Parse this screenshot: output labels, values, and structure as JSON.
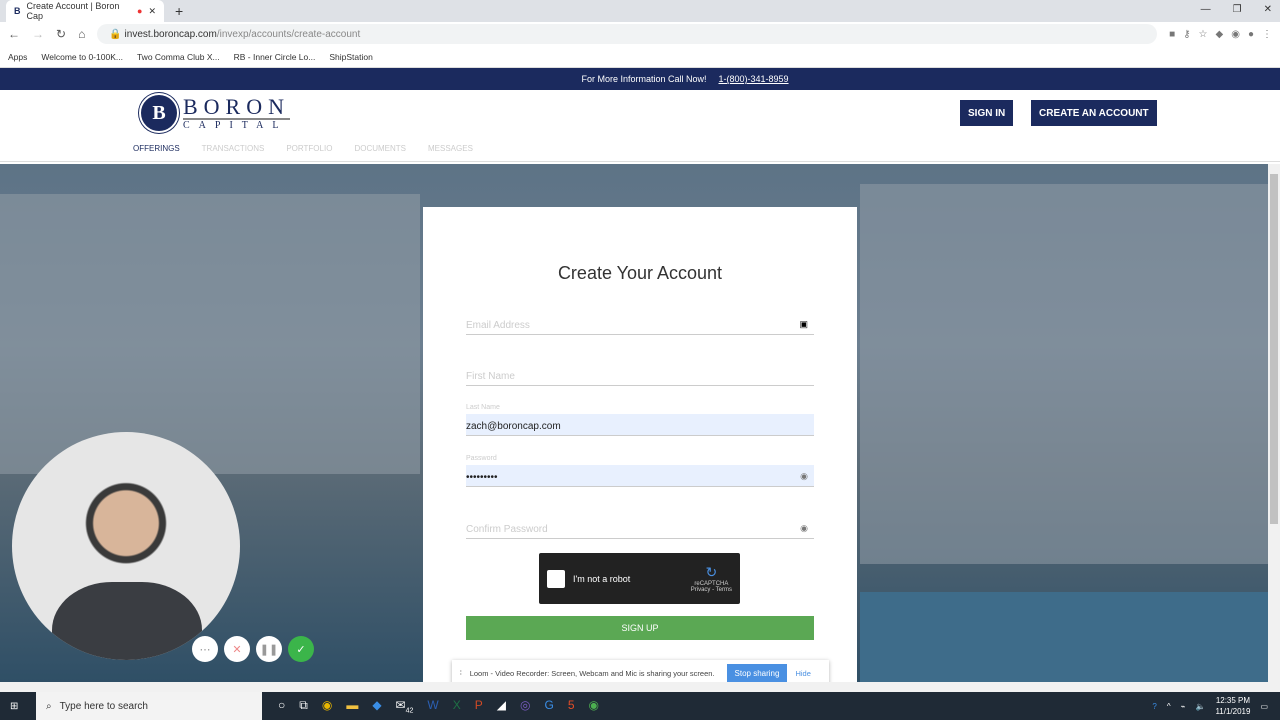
{
  "browser": {
    "tab_title": "Create Account | Boron Cap",
    "url_domain": "invest.boroncap.com",
    "url_path": "/invexp/accounts/create-account",
    "bookmarks": [
      "Apps",
      "Welcome to 0-100K...",
      "Two Comma Club X...",
      "RB - Inner Circle Lo...",
      "ShipStation"
    ]
  },
  "topbar": {
    "text": "For More Information Call Now!",
    "phone": "1-(800)-341-8959"
  },
  "logo": {
    "name": "BORON",
    "sub": "CAPITAL",
    "seal": "B"
  },
  "nav": [
    "OFFERINGS",
    "TRANSACTIONS",
    "PORTFOLIO",
    "DOCUMENTS",
    "MESSAGES"
  ],
  "header": {
    "sign_in": "SIGN IN",
    "create": "CREATE AN ACCOUNT"
  },
  "form": {
    "title": "Create Your Account",
    "email_placeholder": "Email Address",
    "first_placeholder": "First Name",
    "last_label": "Last Name",
    "last_value": "zach@boroncap.com",
    "password_label": "Password",
    "password_value": "•••••••••",
    "confirm_placeholder": "Confirm Password",
    "captcha": "I'm not a robot",
    "captcha_brand": "reCAPTCHA",
    "captcha_links": "Privacy - Terms",
    "signup": "SIGN UP"
  },
  "loom": {
    "message": "Loom - Video Recorder: Screen, Webcam and Mic is sharing your screen.",
    "stop": "Stop sharing",
    "hide": "Hide"
  },
  "taskbar": {
    "search": "Type here to search",
    "time": "12:35 PM",
    "date": "11/1/2019",
    "mail_badge": "42"
  },
  "colors": {
    "navy": "#1b2a5e",
    "green": "#5ba854"
  }
}
